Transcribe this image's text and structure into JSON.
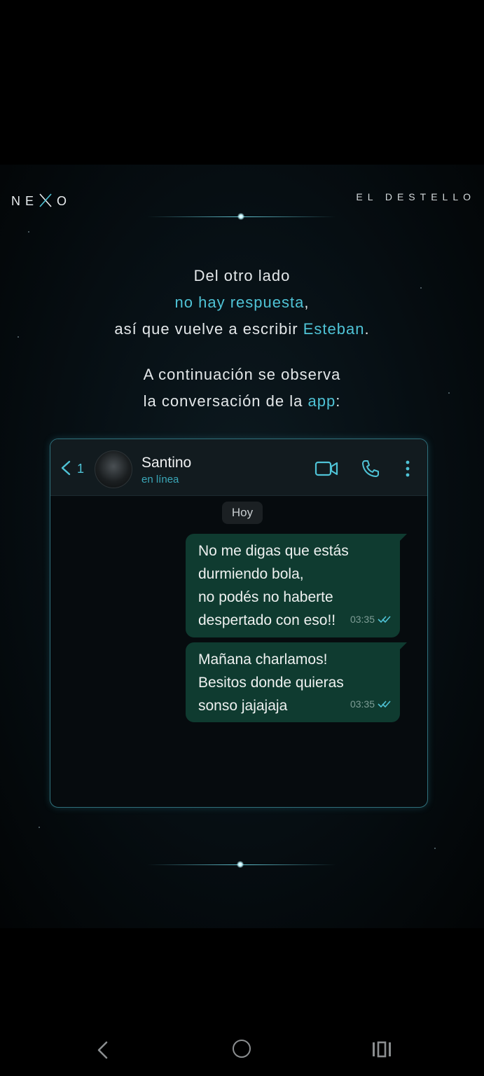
{
  "header": {
    "brand": "NE O",
    "series": "EL DESTELLO"
  },
  "intro": {
    "line1": "Del otro lado",
    "line2_highlight": "no hay respuesta",
    "line2_suffix": ",",
    "line3_prefix": "así que vuelve a escribir ",
    "line3_highlight": "Esteban",
    "line3_suffix": ".",
    "line4": "A continuación se observa",
    "line5_prefix": "la conversación de la ",
    "line5_highlight": "app",
    "line5_suffix": ":"
  },
  "chat": {
    "unread_count": "1",
    "contact_name": "Santino",
    "contact_status": "en línea",
    "day_label": "Hoy",
    "messages": [
      {
        "lines": [
          "No me digas que estás",
          "durmiendo bola,",
          "no podés no haberte",
          "despertado con eso!!"
        ],
        "time": "03:35",
        "status": "read"
      },
      {
        "lines": [
          "Mañana charlamos!",
          "Besitos donde quieras",
          "sonso jajajaja"
        ],
        "time": "03:35",
        "status": "read"
      }
    ]
  },
  "colors": {
    "accent": "#4fc3d6",
    "bubble": "#0f3b30",
    "background": "#000000"
  },
  "icons": [
    "back-chevron-icon",
    "video-call-icon",
    "phone-icon",
    "more-vertical-icon",
    "double-check-icon",
    "nav-back-icon",
    "nav-home-icon",
    "nav-recents-icon"
  ]
}
